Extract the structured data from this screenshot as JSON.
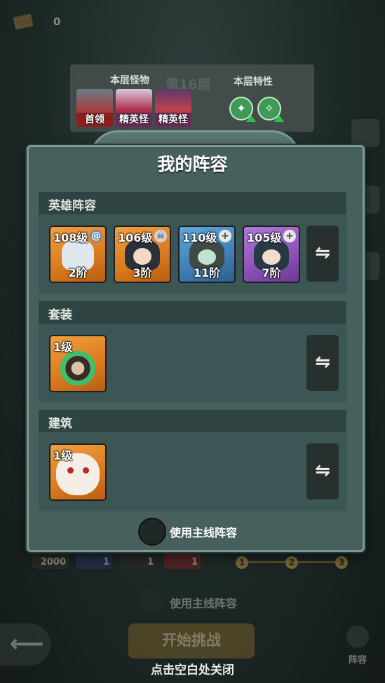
{
  "colors": {
    "modal_bg": "#47605e",
    "section_bg": "#3b5654",
    "section_head": "#2f4442",
    "card_orange": "#e08a2a",
    "card_blue": "#3f7fb5",
    "card_purple": "#8a52b5"
  },
  "top": {
    "currency_value": "0",
    "currency_icon": "ticket-icon"
  },
  "floor": {
    "monsters_label": "本层怪物",
    "title": "第16层",
    "traits_label": "本层特性",
    "monsters": [
      {
        "tag": "首领",
        "icon": "boss-icon"
      },
      {
        "tag": "精英怪",
        "icon": "elite-icon"
      },
      {
        "tag": "精英怪",
        "icon": "elite-icon"
      }
    ],
    "traits": [
      {
        "icon": "trait-up-icon"
      },
      {
        "icon": "trait-up-icon"
      }
    ]
  },
  "modal": {
    "title": "我的阵容",
    "heroes_section": "英雄阵容",
    "heroes": [
      {
        "level": "108级",
        "rank": "2阶",
        "badge": "spiral-icon"
      },
      {
        "level": "106级",
        "rank": "3阶",
        "badge": "skull-icon"
      },
      {
        "level": "110级",
        "rank": "11阶",
        "badge": "plus-icon"
      },
      {
        "level": "105级",
        "rank": "7阶",
        "badge": "plus-icon"
      }
    ],
    "set_section": "套装",
    "set_item": {
      "level": "1级"
    },
    "building_section": "建筑",
    "building_item": {
      "level": "1级"
    },
    "use_mainline": "使用主线阵容"
  },
  "background": {
    "slots": [
      "2000",
      "1",
      "1",
      "1"
    ],
    "progress": [
      "1",
      "2",
      "3"
    ],
    "use_mainline": "使用主线阵容",
    "start_challenge": "开始挑战",
    "lineup": "阵容"
  },
  "close_hint": "点击空白处关闭"
}
